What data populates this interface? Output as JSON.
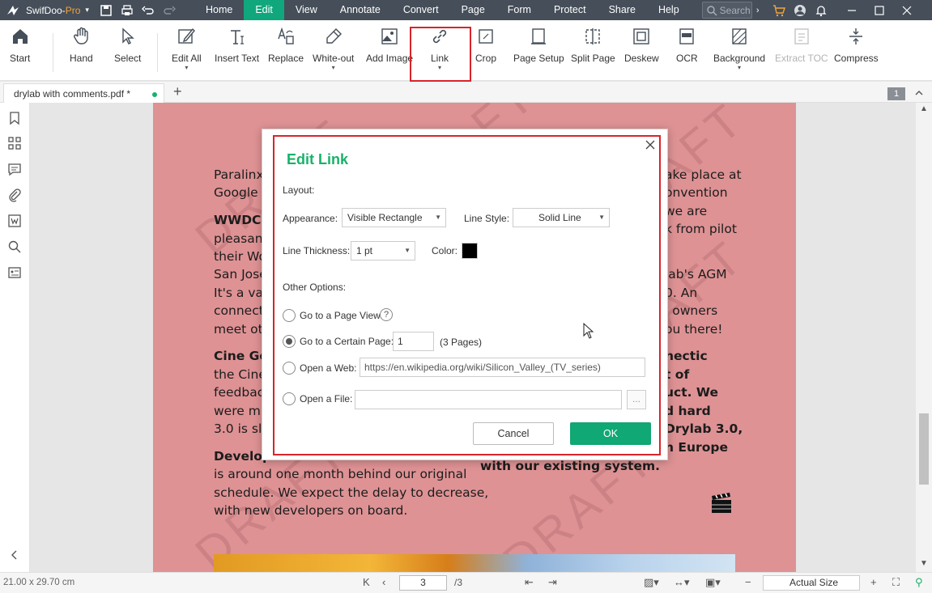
{
  "app": {
    "name": "SwifDoo-",
    "name_suffix": "Pro"
  },
  "menu": [
    "Home",
    "Edit",
    "View",
    "Annotate",
    "Convert",
    "Page",
    "Form",
    "Protect",
    "Share",
    "Help"
  ],
  "search": {
    "placeholder": "Search"
  },
  "toolbar": {
    "start": "Start",
    "hand": "Hand",
    "select": "Select",
    "edit_all": "Edit All",
    "insert_text": "Insert Text",
    "replace": "Replace",
    "white_out": "White-out",
    "add_image": "Add Image",
    "link": "Link",
    "crop": "Crop",
    "page_setup": "Page Setup",
    "split_page": "Split Page",
    "deskew": "Deskew",
    "ocr": "OCR",
    "background": "Background",
    "extract_toc": "Extract TOC",
    "compress": "Compress"
  },
  "tab": {
    "title": "drylab with comments.pdf *",
    "page_count_badge": "1"
  },
  "document": {
    "watermark": "DRAFT",
    "left_lines": [
      "Paralinx",
      "Google a",
      "WWDC",
      "pleasant",
      "their Wo",
      "San Jose",
      "It's a valu",
      "connecti",
      "meet oth",
      "Cine Ge",
      "the Cine",
      "feedback",
      "were mix",
      "3.0 is slig",
      "Develop",
      "is around one month behind our original",
      "schedule. We expect the delay to decrease,",
      "with new developers on board."
    ],
    "right_lines": [
      "ake place at",
      "onvention",
      "we are",
      "k from pilot",
      "lab's AGM",
      "0. An",
      "l owners",
      "ou there!",
      "hectic",
      "t of",
      "uct. We",
      "d hard",
      "Drylab 3.0,",
      "n Europe",
      "with our existing system."
    ]
  },
  "dialog": {
    "title": "Edit Link",
    "layout_label": "Layout:",
    "appearance_label": "Appearance:",
    "appearance_value": "Visible Rectangle",
    "line_style_label": "Line Style:",
    "line_style_value": "Solid Line",
    "line_thickness_label": "Line Thickness:",
    "line_thickness_value": "1 pt",
    "color_label": "Color:",
    "color_value": "#000000",
    "other_options_label": "Other Options:",
    "opt_page_view": "Go to a Page View",
    "opt_certain_page": "Go to a Certain Page:",
    "page_number": "1",
    "page_total": "(3 Pages)",
    "opt_web": "Open a Web:",
    "web_url": "https://en.wikipedia.org/wiki/Silicon_Valley_(TV_series)",
    "opt_file": "Open a File:",
    "file_path": "",
    "browse": "...",
    "cancel": "Cancel",
    "ok": "OK"
  },
  "status": {
    "dimensions": "21.00 x 29.70 cm",
    "current_page": "3",
    "total_pages": "/3",
    "zoom": "Actual Size"
  },
  "colors": {
    "accent": "#10a874",
    "titlebar": "#454e59",
    "highlight": "#d8242b",
    "page_bg": "#de9294"
  }
}
